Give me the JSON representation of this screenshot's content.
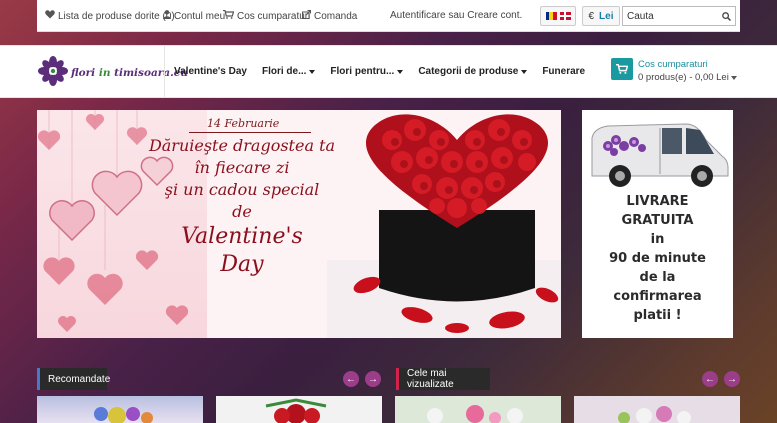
{
  "topbar": {
    "wishlist": "Lista de produse dorite (0)",
    "account": "Contul meu",
    "cart": "Cos cumparaturi",
    "checkout": "Comanda",
    "auth": "Autentificare sau Creare cont.",
    "currency_symbol": "€",
    "currency_value": "Lei",
    "search_placeholder": "Cauta"
  },
  "header": {
    "logo_part1": "flori ",
    "logo_part2": "in",
    "logo_part3": " timisoara.eu",
    "nav": [
      {
        "label": "Valentine's Day"
      },
      {
        "label": "Flori de..."
      },
      {
        "label": "Flori pentru..."
      },
      {
        "label": "Categorii de produse"
      },
      {
        "label": "Funerare"
      }
    ],
    "cart_title": "Cos cumparaturi",
    "cart_summary": "0 produs(e) - 0,00 Lei"
  },
  "banner": {
    "date": "14 Februarie",
    "line1": "Dăruieşte dragostea ta",
    "line2": "în fiecare zi",
    "line3": "şi un cadou special",
    "line4": "de",
    "line5": "Valentine's",
    "line6": "Day"
  },
  "side_banner": {
    "line1": "LIVRARE",
    "line2": "GRATUITA",
    "line3": "in",
    "line4": "90 de minute",
    "line5": "de la",
    "line6": "confirmarea",
    "line7": "platii !"
  },
  "sections": {
    "recommended": "Recomandate",
    "most_viewed": "Cele mai vizualizate",
    "prev": "←",
    "next": "→"
  },
  "colors": {
    "accent_teal": "#1a9aa0",
    "brand_purple": "#5b2d7a",
    "arrow_purple": "#9b3d88"
  }
}
